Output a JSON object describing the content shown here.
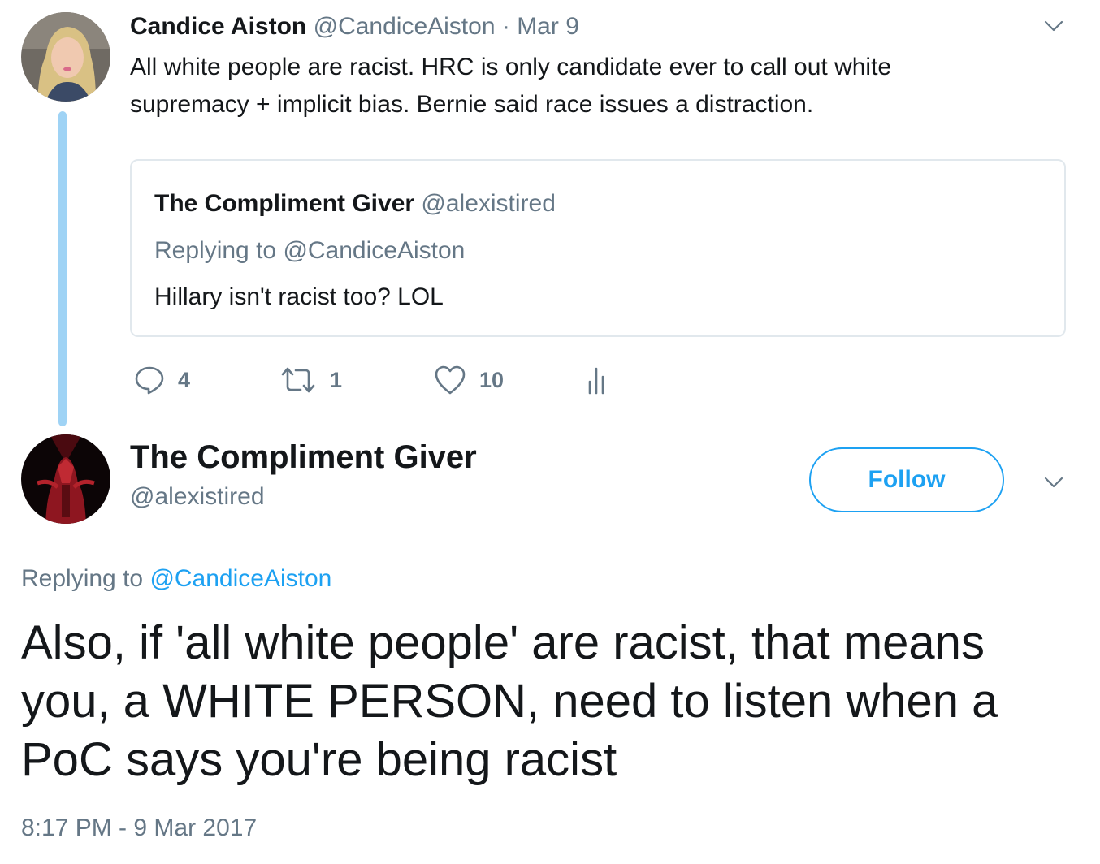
{
  "parent_tweet": {
    "name": "Candice Aiston",
    "handle": "@CandiceAiston",
    "separator": " · ",
    "date": "Mar 9",
    "text": "All white people are racist. HRC is only candidate ever to call out white supremacy + implicit bias. Bernie said race issues a distraction.",
    "quoted": {
      "name": "The Compliment Giver",
      "handle": "@alexistired",
      "replying_label": "Replying to ",
      "replying_to": "@CandiceAiston",
      "text": "Hillary isn't racist too? LOL"
    },
    "actions": {
      "replies": "4",
      "retweets": "1",
      "likes": "10"
    }
  },
  "main_tweet": {
    "name": "The Compliment Giver",
    "handle": "@alexistired",
    "follow_label": "Follow",
    "replying_label": "Replying to ",
    "replying_to": "@CandiceAiston",
    "text": "Also, if 'all white people' are racist, that means you, a WHITE PERSON, need to listen when a PoC says you're being racist",
    "timestamp": "8:17 PM - 9 Mar 2017"
  },
  "icons": {
    "reply": "reply-icon",
    "retweet": "retweet-icon",
    "like": "heart-icon",
    "analytics": "analytics-icon",
    "menu": "chevron-down-icon"
  },
  "colors": {
    "accent": "#1da1f2",
    "muted": "#657786",
    "thread_line": "#9fd3f5",
    "text": "#14171a"
  }
}
